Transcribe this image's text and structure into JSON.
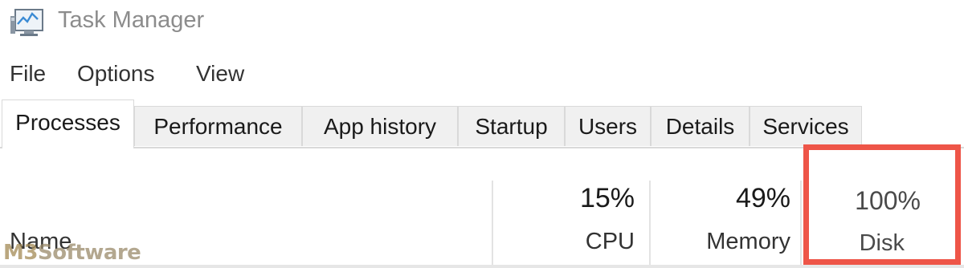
{
  "window": {
    "title": "Task Manager",
    "icon": "task-manager-icon"
  },
  "menu": [
    "File",
    "Options",
    "View"
  ],
  "tabs": [
    {
      "label": "Processes",
      "active": true
    },
    {
      "label": "Performance",
      "active": false
    },
    {
      "label": "App history",
      "active": false
    },
    {
      "label": "Startup",
      "active": false
    },
    {
      "label": "Users",
      "active": false
    },
    {
      "label": "Details",
      "active": false
    },
    {
      "label": "Services",
      "active": false
    }
  ],
  "columns": {
    "name": {
      "label": "Name"
    },
    "cpu": {
      "value": "15%",
      "label": "CPU"
    },
    "memory": {
      "value": "49%",
      "label": "Memory"
    },
    "disk": {
      "value": "100%",
      "label": "Disk"
    }
  },
  "highlight": {
    "target": "disk-column",
    "color": "#ee5548"
  },
  "watermark": {
    "prefix": "M3",
    "text": "Software"
  }
}
